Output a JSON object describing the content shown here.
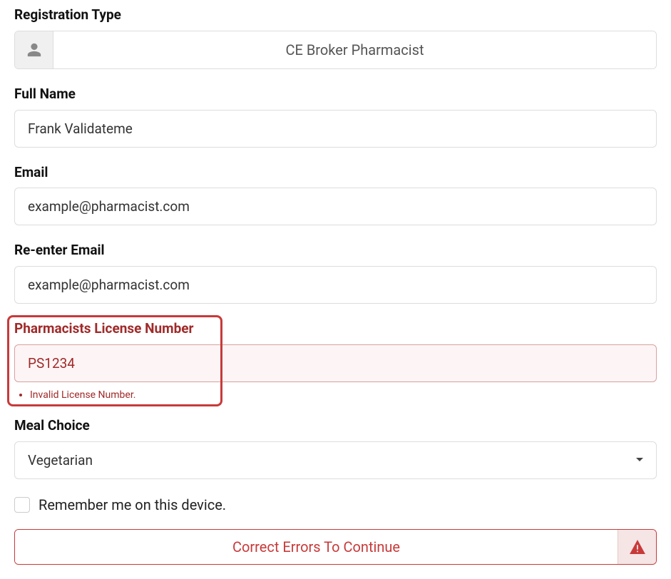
{
  "registrationType": {
    "label": "Registration Type",
    "value": "CE Broker Pharmacist"
  },
  "fullName": {
    "label": "Full Name",
    "value": "Frank Validateme"
  },
  "email": {
    "label": "Email",
    "value": "example@pharmacist.com"
  },
  "reenterEmail": {
    "label": "Re-enter Email",
    "value": "example@pharmacist.com"
  },
  "license": {
    "label": "Pharmacists License Number",
    "value": "PS1234",
    "error": "Invalid License Number."
  },
  "mealChoice": {
    "label": "Meal Choice",
    "value": "Vegetarian"
  },
  "remember": {
    "label": "Remember me on this device."
  },
  "submit": {
    "label": "Correct Errors To Continue"
  }
}
